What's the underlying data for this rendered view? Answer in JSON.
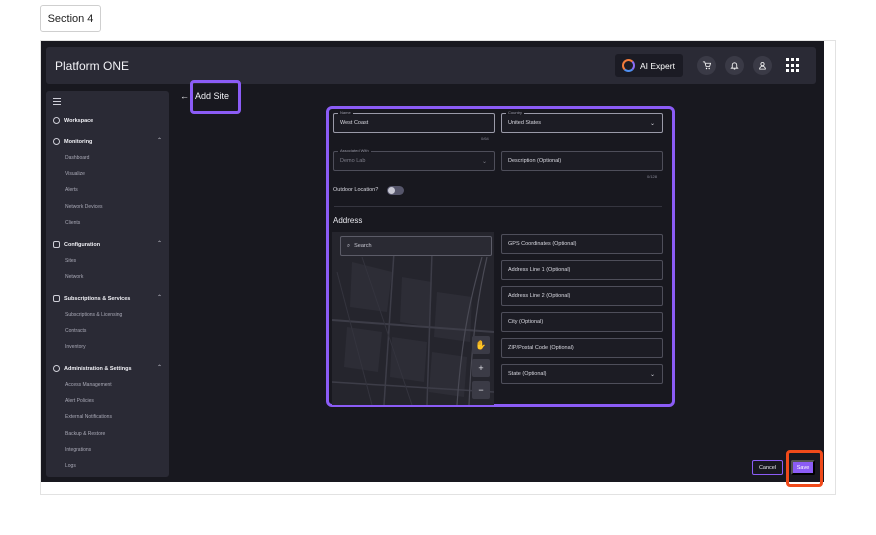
{
  "section_tag": "Section 4",
  "brand": "Platform ONE",
  "header": {
    "ai_label": "AI Expert",
    "icons": [
      "cart-icon",
      "bell-icon",
      "user-icon",
      "apps-grid-icon"
    ]
  },
  "sidebar": {
    "workspace": "Workspace",
    "groups": [
      {
        "label": "Monitoring",
        "icon": "monitor-icon",
        "items": [
          "Dashboard",
          "Visualize",
          "Alerts",
          "Network Devices",
          "Clients"
        ]
      },
      {
        "label": "Configuration",
        "icon": "list-icon",
        "items": [
          "Sites",
          "Network"
        ]
      },
      {
        "label": "Subscriptions & Services",
        "icon": "subscription-icon",
        "items": [
          "Subscriptions & Licensing",
          "Contracts",
          "Inventory"
        ]
      },
      {
        "label": "Administration & Settings",
        "icon": "settings-icon",
        "items": [
          "Access Management",
          "Alert Policies",
          "External Notifications",
          "Backup & Restore",
          "Integrations",
          "Logs"
        ]
      }
    ]
  },
  "page_title": "Add Site",
  "form": {
    "name_label": "Name",
    "name_value": "West Coast",
    "name_counter": "0/64",
    "country_label": "Country",
    "country_value": "United States",
    "associated_label": "Associated With",
    "associated_value": "Demo Lab",
    "description_placeholder": "Description (Optional)",
    "description_counter": "0/128",
    "outdoor_label": "Outdoor Location?",
    "address_heading": "Address",
    "map_search_placeholder": "Search",
    "gps_placeholder": "GPS Coordinates (Optional)",
    "address1_placeholder": "Address Line 1 (Optional)",
    "address2_placeholder": "Address Line 2 (Optional)",
    "city_placeholder": "City (Optional)",
    "zip_placeholder": "ZIP/Postal Code (Optional)",
    "state_placeholder": "State (Optional)"
  },
  "buttons": {
    "cancel": "Cancel",
    "save": "Save"
  },
  "colors": {
    "accent": "#8b5cf6",
    "highlight_save": "#f04a1a",
    "background": "#18181f"
  }
}
